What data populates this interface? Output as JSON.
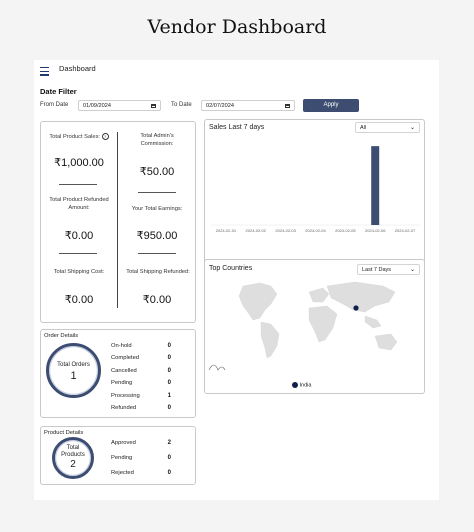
{
  "page": {
    "title": "Vendor Dashboard"
  },
  "nav": {
    "label": "Dashboard"
  },
  "date_filter": {
    "title": "Date Filter",
    "from_label": "From Date",
    "from_value": "01/09/2024",
    "to_label": "To Date",
    "to_value": "02/07/2024",
    "apply_label": "Apply"
  },
  "stats": {
    "total_product_sales_label": "Total Product Sales:",
    "total_product_sales_value": "₹1,000.00",
    "admin_commission_label_1": "Total Admin's",
    "admin_commission_label_2": "Commission:",
    "admin_commission_value": "₹50.00",
    "refunded_label_1": "Total Product Refunded",
    "refunded_label_2": "Amount:",
    "refunded_value": "₹0.00",
    "earnings_label": "Your Total Earnings:",
    "earnings_value": "₹950.00",
    "shipping_cost_label": "Total Shipping Cost:",
    "shipping_cost_value": "₹0.00",
    "shipping_refunded_label": "Total Shipping Refunded:",
    "shipping_refunded_value": "₹0.00"
  },
  "sales_chart": {
    "title": "Sales Last 7 days",
    "filter_value": "All",
    "legend": {
      "earnings": "Earnings",
      "sales": "Sales"
    },
    "colors": {
      "earnings": "#3d4d72",
      "sales": "#dcdcdc"
    }
  },
  "chart_data": {
    "type": "bar",
    "categories": [
      "2024-02-01",
      "2024-02-02",
      "2024-02-03",
      "2024-02-04",
      "2024-02-05",
      "2024-02-06",
      "2024-02-07"
    ],
    "series": [
      {
        "name": "Earnings",
        "values": [
          0,
          0,
          0,
          0,
          0,
          950,
          0
        ]
      },
      {
        "name": "Sales",
        "values": [
          0,
          0,
          0,
          0,
          0,
          0,
          0
        ]
      }
    ],
    "ylim": [
      0,
      1000
    ],
    "title": "Sales Last 7 days"
  },
  "top_countries": {
    "title": "Top Countries",
    "filter_value": "Last 7 Days",
    "legend_country": "India",
    "colors": {
      "marker": "#0f1f4a",
      "land": "#dedede"
    }
  },
  "order_details": {
    "title": "Order Details",
    "circle_label": "Total Orders",
    "circle_value": "1",
    "rows": [
      {
        "label": "On-hold",
        "value": "0"
      },
      {
        "label": "Completed",
        "value": "0"
      },
      {
        "label": "Cancelled",
        "value": "0"
      },
      {
        "label": "Pending",
        "value": "0"
      },
      {
        "label": "Processing",
        "value": "1"
      },
      {
        "label": "Refunded",
        "value": "0"
      }
    ]
  },
  "product_details": {
    "title": "Product Details",
    "circle_label_1": "Total",
    "circle_label_2": "Products",
    "circle_value": "2",
    "rows": [
      {
        "label": "Approved",
        "value": "2"
      },
      {
        "label": "Pending",
        "value": "0"
      },
      {
        "label": "Rejected",
        "value": "0"
      }
    ]
  }
}
